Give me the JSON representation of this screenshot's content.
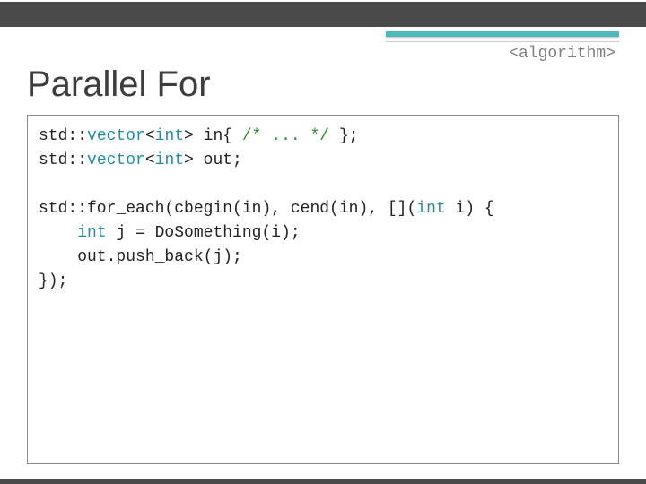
{
  "header": {
    "label": "<algorithm>"
  },
  "title": "Parallel For",
  "code": {
    "l1a": "std::",
    "l1b": "vector",
    "l1c": "<",
    "l1d": "int",
    "l1e": "> in{ ",
    "l1f": "/* ... */",
    "l1g": " };",
    "l2a": "std::",
    "l2b": "vector",
    "l2c": "<",
    "l2d": "int",
    "l2e": "> out;",
    "l4a": "std::for_each(cbegin(in), cend(in), [](",
    "l4b": "int",
    "l4c": " i) {",
    "l5a": "    ",
    "l5b": "int",
    "l5c": " j = DoSomething(i);",
    "l6": "    out.push_back(j);",
    "l7": "});"
  }
}
